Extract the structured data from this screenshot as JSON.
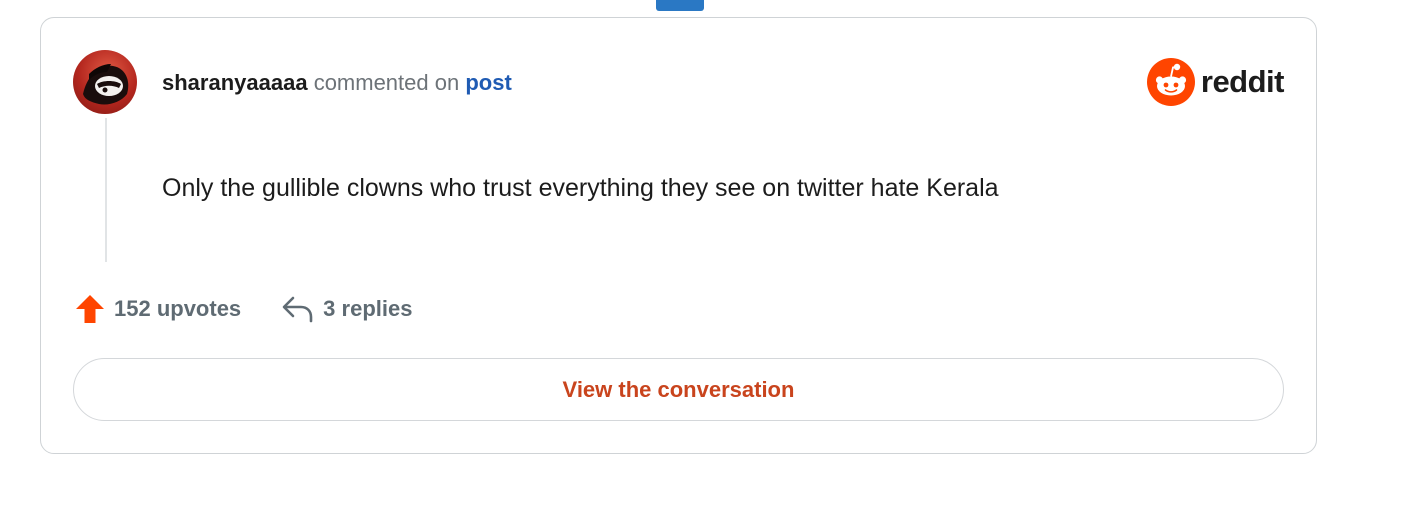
{
  "comment": {
    "username": "sharanyaaaaa",
    "action_text": "commented on",
    "target_link": "post",
    "body": "Only the gullible clowns who trust everything they see on twitter hate Kerala"
  },
  "brand": {
    "name": "reddit",
    "icon": "reddit-snoo-icon",
    "color": "#ff4500"
  },
  "stats": {
    "upvotes_label": "152 upvotes",
    "replies_label": "3 replies",
    "upvote_icon": "upvote-arrow-icon",
    "reply_icon": "reply-arrow-icon",
    "upvote_color": "#ff4500"
  },
  "cta": {
    "label": "View the conversation",
    "color": "#c9441d"
  }
}
